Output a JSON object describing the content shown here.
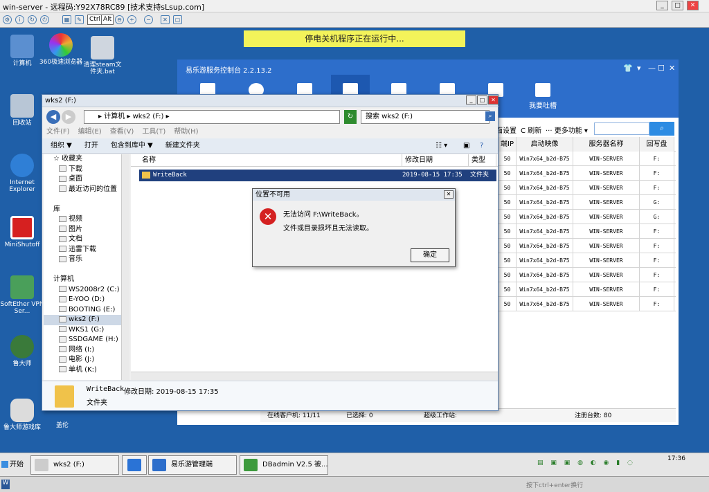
{
  "remote": {
    "title": "win-server - 远程码:Y92X78RC89  [技术支持sLsup.com]",
    "toolbar_keys": [
      "Ctrl",
      "Alt"
    ]
  },
  "banner": "停电关机程序正在运行中...",
  "desktop_icons": [
    {
      "label": "计算机",
      "color": "#5b8fd0"
    },
    {
      "label": "360极速浏览器",
      "color": "#e8a21c"
    },
    {
      "label": "清理steam文件夹.bat",
      "color": "#cfd6df"
    },
    {
      "label": "回收站",
      "color": "#b8c6d6"
    },
    {
      "label": "Internet Explorer",
      "color": "#2f7fd6"
    },
    {
      "label": "MiniShutoff",
      "color": "#d62020"
    },
    {
      "label": "SoftEther VPN Ser...",
      "color": "#4a9f5a"
    },
    {
      "label": "鲁大师",
      "color": "#3a7a3a"
    },
    {
      "label": "鲁大师游戏库",
      "color": "#dcdcdc"
    },
    {
      "label": "盖伦",
      "color": "#7aa7d7"
    }
  ],
  "app": {
    "title": "易乐游服务控制台 2.2.13.2",
    "nav": [
      "",
      "",
      "",
      "",
      "",
      "",
      "心",
      "我要吐槽"
    ],
    "toolbar": {
      "settings": "面设置",
      "refresh": "刷新",
      "more": "··· 更多功能"
    },
    "columns": [
      "端IP",
      "启动映像",
      "服务器名称",
      "回写盘"
    ],
    "rows": [
      [
        "50",
        "Win7x64_b2d-B75",
        "WIN-SERVER",
        "F:"
      ],
      [
        "50",
        "Win7x64_b2d-B75",
        "WIN-SERVER",
        "F:"
      ],
      [
        "50",
        "Win7x64_b2d-B75",
        "WIN-SERVER",
        "F:"
      ],
      [
        "50",
        "Win7x64_b2d-B75",
        "WIN-SERVER",
        "G:"
      ],
      [
        "50",
        "Win7x64_b2d-B75",
        "WIN-SERVER",
        "G:"
      ],
      [
        "50",
        "Win7x64_b2d-B75",
        "WIN-SERVER",
        "F:"
      ],
      [
        "50",
        "Win7x64_b2d-B75",
        "WIN-SERVER",
        "F:"
      ],
      [
        "50",
        "Win7x64_b2d-B75",
        "WIN-SERVER",
        "F:"
      ],
      [
        "50",
        "Win7x64_b2d-B75",
        "WIN-SERVER",
        "F:"
      ],
      [
        "50",
        "Win7x64_b2d-B75",
        "WIN-SERVER",
        "F:"
      ],
      [
        "50",
        "Win7x64_b2d-B75",
        "WIN-SERVER",
        "F:"
      ]
    ],
    "status": {
      "online": "在线客户机: 11/11",
      "selected": "已选择: 0",
      "super": "超级工作站:",
      "registered": "注册台数: 80"
    }
  },
  "explorer": {
    "title": "wks2 (F:)",
    "address": "▸ 计算机 ▸ wks2 (F:) ▸",
    "search_placeholder": "搜索 wks2 (F:)",
    "menu": [
      "文件(F)",
      "编辑(E)",
      "查看(V)",
      "工具(T)",
      "帮助(H)"
    ],
    "commands": [
      "组织 ▼",
      "打开",
      "包含到库中 ▼",
      "新建文件夹"
    ],
    "tree": [
      {
        "label": "☆ 收藏夹",
        "indent": 0
      },
      {
        "label": "下载",
        "indent": 1
      },
      {
        "label": "桌面",
        "indent": 1
      },
      {
        "label": "最近访问的位置",
        "indent": 1
      },
      {
        "label": "",
        "indent": 0
      },
      {
        "label": "库",
        "indent": 0
      },
      {
        "label": "视频",
        "indent": 1
      },
      {
        "label": "图片",
        "indent": 1
      },
      {
        "label": "文档",
        "indent": 1
      },
      {
        "label": "迅雷下载",
        "indent": 1
      },
      {
        "label": "音乐",
        "indent": 1
      },
      {
        "label": "",
        "indent": 0
      },
      {
        "label": "计算机",
        "indent": 0
      },
      {
        "label": "WS2008r2 (C:)",
        "indent": 1
      },
      {
        "label": "E-YOO (D:)",
        "indent": 1
      },
      {
        "label": "BOOTING (E:)",
        "indent": 1
      },
      {
        "label": "wks2 (F:)",
        "indent": 1,
        "selected": true
      },
      {
        "label": "WKS1 (G:)",
        "indent": 1
      },
      {
        "label": "SSDGAME (H:)",
        "indent": 1
      },
      {
        "label": "网络 (I:)",
        "indent": 1
      },
      {
        "label": "电影 (J:)",
        "indent": 1
      },
      {
        "label": "单机 (K:)",
        "indent": 1
      }
    ],
    "columns": [
      "名称",
      "修改日期",
      "类型"
    ],
    "file": {
      "name": "WriteBack",
      "date": "2019-08-15 17:35",
      "type": "文件夹"
    },
    "detail": {
      "name": "WriteBack",
      "modified": "修改日期: 2019-08-15 17:35",
      "type": "文件夹"
    }
  },
  "dialog": {
    "title": "位置不可用",
    "line1": "无法访问 F:\\WriteBack。",
    "line2": "文件或目录损坏且无法读取。",
    "ok": "确定"
  },
  "taskbar": {
    "start": "开始",
    "items": [
      "wks2 (F:)",
      "",
      "易乐游管理端",
      "DBadmin V2.5 被..."
    ],
    "clock": "17:36"
  },
  "bottom": {
    "hint": "按下ctrl+enter换行"
  }
}
